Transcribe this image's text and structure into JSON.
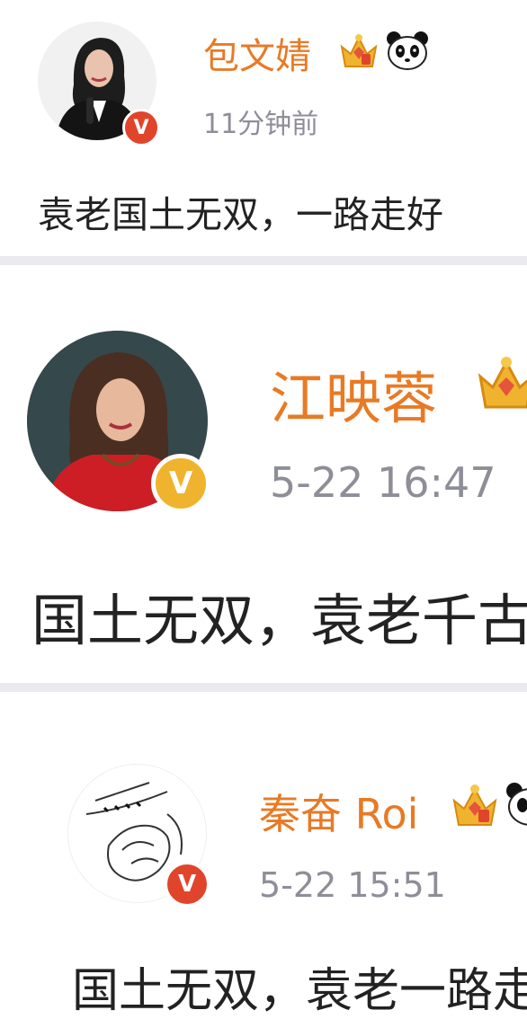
{
  "posts": [
    {
      "user": "包文婧",
      "time": "11分钟前",
      "text": "袁老国土无双，一路走好",
      "badge": "V",
      "icons": [
        "avatar",
        "verified-badge-icon",
        "crown-icon",
        "panda-icon"
      ]
    },
    {
      "user": "江映蓉",
      "time": "5-22 16:47",
      "text": "国土无双，袁老千古",
      "badge": "V",
      "icons": [
        "avatar",
        "verified-badge-icon",
        "crown-icon"
      ]
    },
    {
      "user": "秦奋 Roi",
      "time": "5-22 15:51",
      "text": "国土无双，袁老一路走好",
      "badge": "V",
      "icons": [
        "avatar",
        "verified-badge-icon",
        "crown-icon",
        "panda-icon"
      ]
    }
  ],
  "colors": {
    "username": "#e87a25",
    "timestamp": "#8e8e99",
    "body_text": "#222222",
    "badge_red": "#e0452b",
    "badge_gold": "#f0b32e",
    "divider": "#e9e9ee"
  }
}
